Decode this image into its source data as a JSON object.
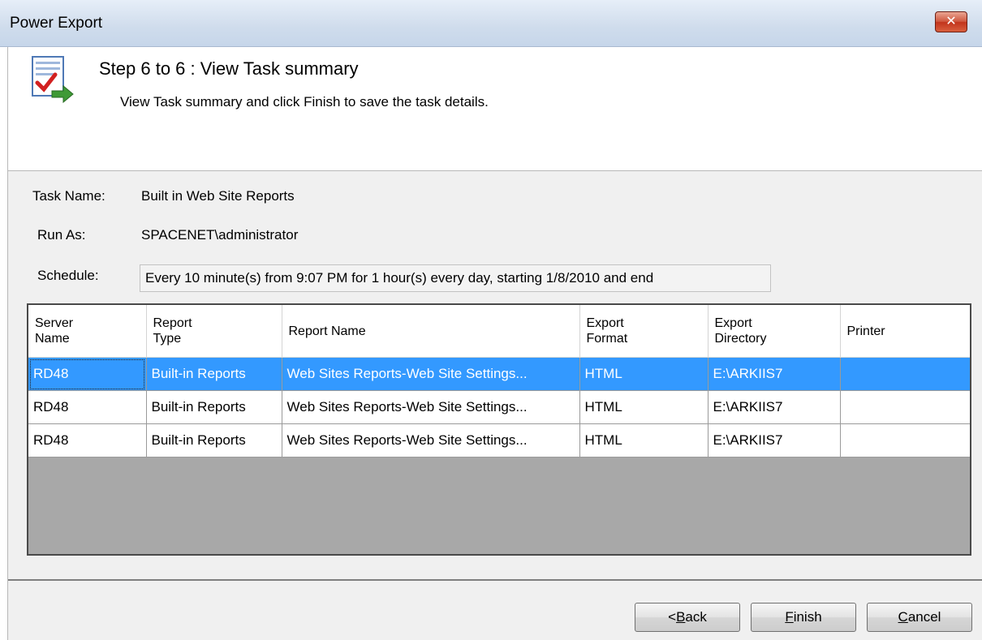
{
  "window": {
    "title": "Power Export",
    "close_glyph": "✕"
  },
  "header": {
    "icon": "task-summary-icon",
    "step_title": "Step 6 to 6 : View Task summary",
    "description": "View Task summary and click Finish to save the task details."
  },
  "summary": {
    "task_name_label": "Task Name:",
    "task_name_value": "Built in Web Site Reports",
    "run_as_label": "Run As:",
    "run_as_value": "SPACENET\\administrator",
    "schedule_label": "Schedule:",
    "schedule_value": "Every 10 minute(s) from 9:07 PM for 1 hour(s) every day, starting 1/8/2010 and end"
  },
  "grid": {
    "columns": [
      "Server\nName",
      "Report\nType",
      "Report Name",
      "Export\nFormat",
      "Export\nDirectory",
      "Printer"
    ],
    "rows": [
      {
        "server": "RD48",
        "type": "Built-in Reports",
        "name": "Web Sites Reports-Web Site Settings...",
        "format": "HTML",
        "directory": "E:\\ARKIIS7",
        "printer": ""
      },
      {
        "server": "RD48",
        "type": "Built-in Reports",
        "name": "Web Sites Reports-Web Site Settings...",
        "format": "HTML",
        "directory": "E:\\ARKIIS7",
        "printer": ""
      },
      {
        "server": "RD48",
        "type": "Built-in Reports",
        "name": "Web Sites Reports-Web Site Settings...",
        "format": "HTML",
        "directory": "E:\\ARKIIS7",
        "printer": ""
      }
    ],
    "selected_row": 0
  },
  "buttons": {
    "back": {
      "prefix": "<",
      "mnemonic": "B",
      "rest": "ack"
    },
    "finish": {
      "prefix": "",
      "mnemonic": "F",
      "rest": "inish"
    },
    "cancel": {
      "prefix": "",
      "mnemonic": "C",
      "rest": "ancel"
    }
  },
  "colors": {
    "selection": "#3399ff",
    "grid_empty": "#a8a8a8",
    "close_button": "#c2341c"
  }
}
